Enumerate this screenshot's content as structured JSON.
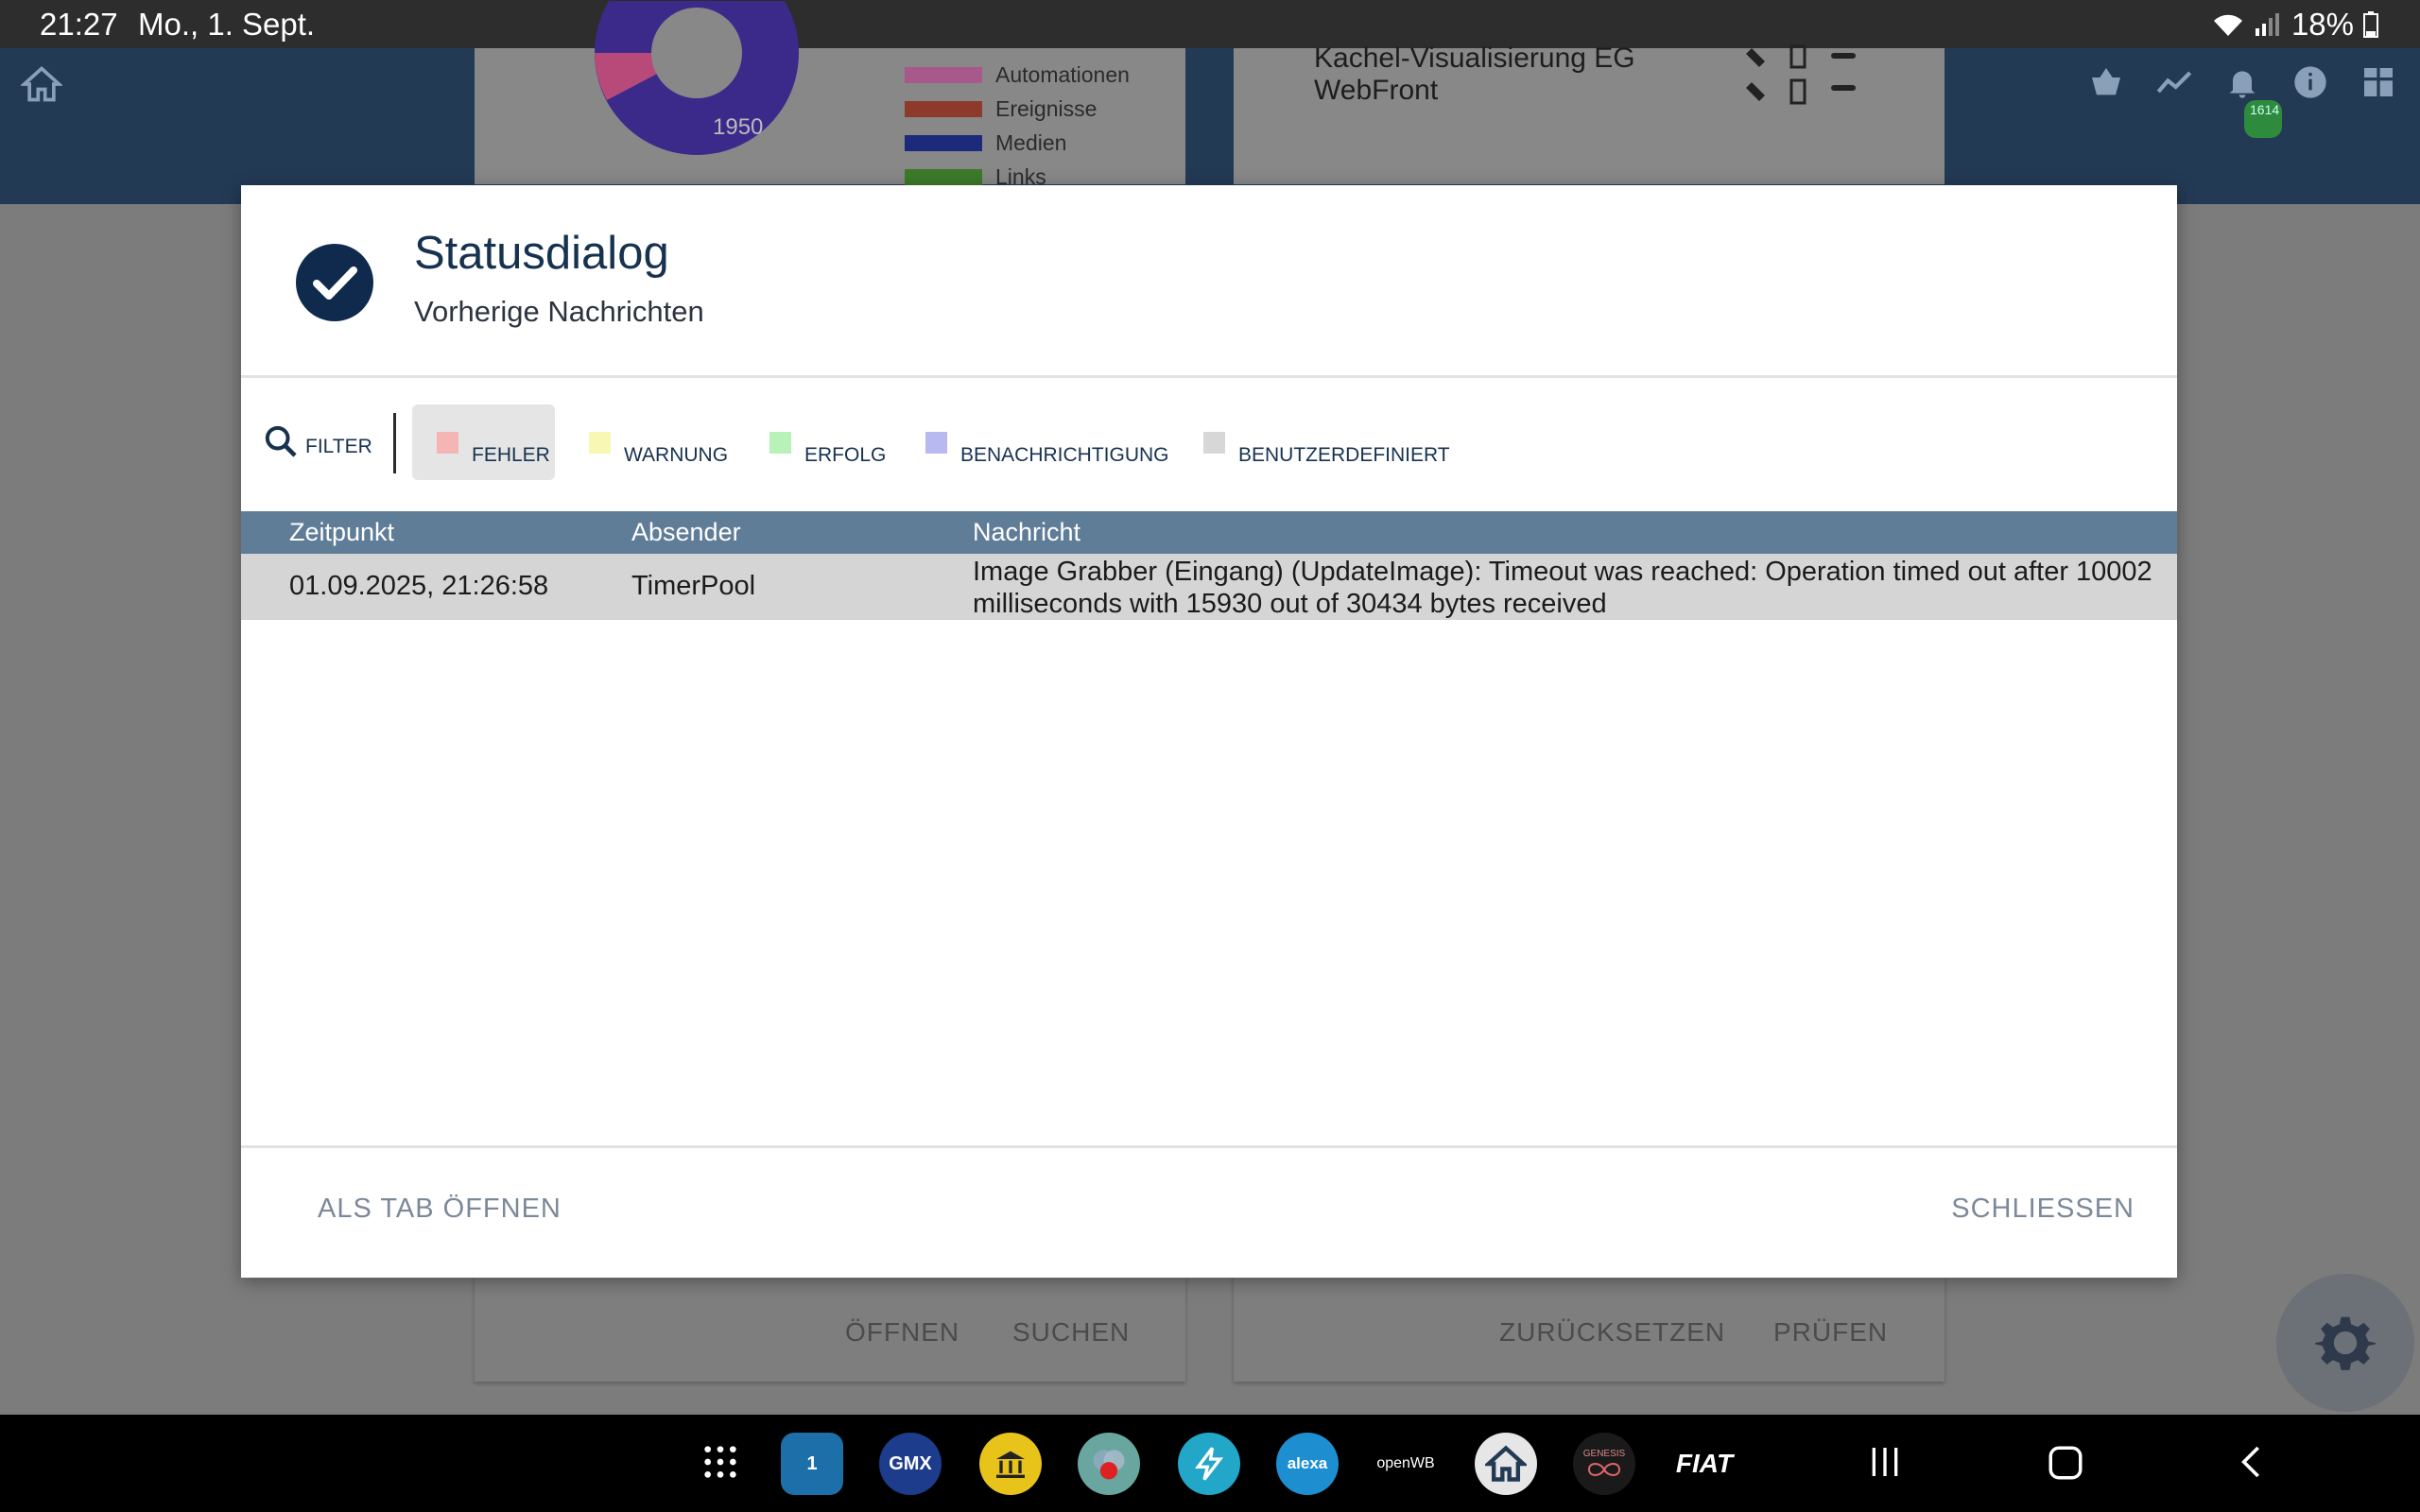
{
  "statusbar": {
    "time": "21:27",
    "date": "Mo., 1. Sept.",
    "battery": "18%"
  },
  "appbar": {
    "badge": "1614"
  },
  "background": {
    "donut_value": "1950",
    "legend": [
      {
        "label": "Automationen",
        "color": "#c65b8a"
      },
      {
        "label": "Ereignisse",
        "color": "#b23c2a"
      },
      {
        "label": "Medien",
        "color": "#1b2a8a"
      },
      {
        "label": "Links",
        "color": "#3c7f2a"
      }
    ],
    "card2_line1": "Kachel-Visualisierung EG",
    "card2_line2": "WebFront",
    "card3_buttons": [
      "ÖFFNEN",
      "SUCHEN"
    ],
    "card4_buttons": [
      "ZURÜCKSETZEN",
      "PRÜFEN"
    ]
  },
  "dialog": {
    "title": "Statusdialog",
    "subtitle": "Vorherige Nachrichten",
    "filter_label": "FILTER",
    "chips": [
      {
        "label": "FEHLER",
        "color": "#f5b5b5",
        "active": true
      },
      {
        "label": "WARNUNG",
        "color": "#f9f7b4",
        "active": false
      },
      {
        "label": "ERFOLG",
        "color": "#b8f2b8",
        "active": false
      },
      {
        "label": "BENACHRICHTIGUNG",
        "color": "#b9b9f2",
        "active": false
      },
      {
        "label": "BENUTZERDEFINIERT",
        "color": "#d7d7d7",
        "active": false
      }
    ],
    "columns": {
      "time": "Zeitpunkt",
      "sender": "Absender",
      "message": "Nachricht"
    },
    "rows": [
      {
        "time": "01.09.2025, 21:26:58",
        "sender": "TimerPool",
        "message": "Image Grabber (Eingang) (UpdateImage): Timeout was reached: Operation timed out after 10002 milliseconds with 15930 out of 30434 bytes received"
      }
    ],
    "footer": {
      "open_tab": "ALS TAB ÖFFNEN",
      "close": "SCHLIESSEN"
    }
  },
  "navbar": {
    "apps": [
      {
        "name": "apps-grid-icon"
      },
      {
        "name": "calendar-app",
        "label": "1",
        "color": "#1c6fa8"
      },
      {
        "name": "gmx-app",
        "label": "GMX",
        "color": "#1e3c8c"
      },
      {
        "name": "bank-app",
        "color": "#e8c31a"
      },
      {
        "name": "circles-app",
        "color": "#6aa6a0"
      },
      {
        "name": "bolt-app",
        "color": "#22a7c9"
      },
      {
        "name": "alexa-app",
        "label": "alexa",
        "color": "#1d8fd1"
      },
      {
        "name": "openwb-app",
        "label": "openWB",
        "color": "#000000"
      },
      {
        "name": "home-app",
        "color": "#e6e6e6"
      },
      {
        "name": "genesis-app",
        "label": "GENESIS",
        "color": "#1a1a1a"
      },
      {
        "name": "fiat-app",
        "label": "FIAT",
        "color": "#000000"
      }
    ]
  }
}
